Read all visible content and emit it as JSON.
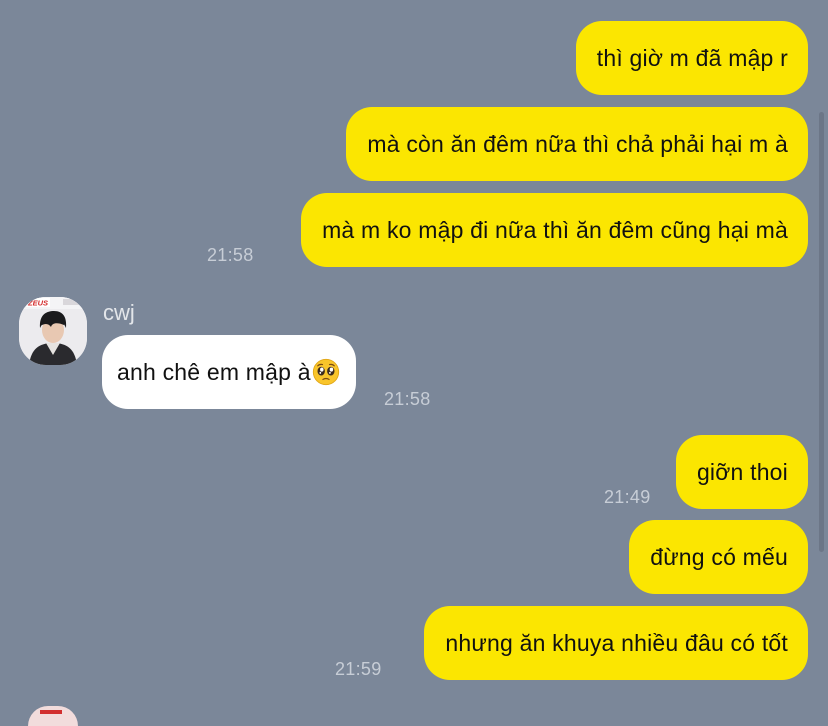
{
  "chat": {
    "messages_out_1": [
      {
        "text": "thì giờ m đã mập r"
      },
      {
        "text": "mà còn ăn đêm nữa thì chả phải hại m à"
      },
      {
        "text": "mà m ko mập đi nữa thì ăn đêm cũng hại mà"
      }
    ],
    "time_out_1": "21:58",
    "incoming": {
      "sender": "cwj",
      "text": "anh chê em mập à",
      "emoji": "pleading-face-emoji",
      "time": "21:58",
      "avatar_label": "ZEUS"
    },
    "messages_out_2a": [
      {
        "text": "giỡn thoi"
      }
    ],
    "time_out_2a": "21:49",
    "messages_out_2b": [
      {
        "text": "đừng có mếu"
      },
      {
        "text": "nhưng ăn khuya nhiều đâu có tốt"
      }
    ],
    "time_out_2b": "21:59"
  },
  "colors": {
    "background": "#7b8799",
    "outgoing_bubble": "#fbe601",
    "incoming_bubble": "#ffffff",
    "timestamp": "#c7cdd6"
  }
}
